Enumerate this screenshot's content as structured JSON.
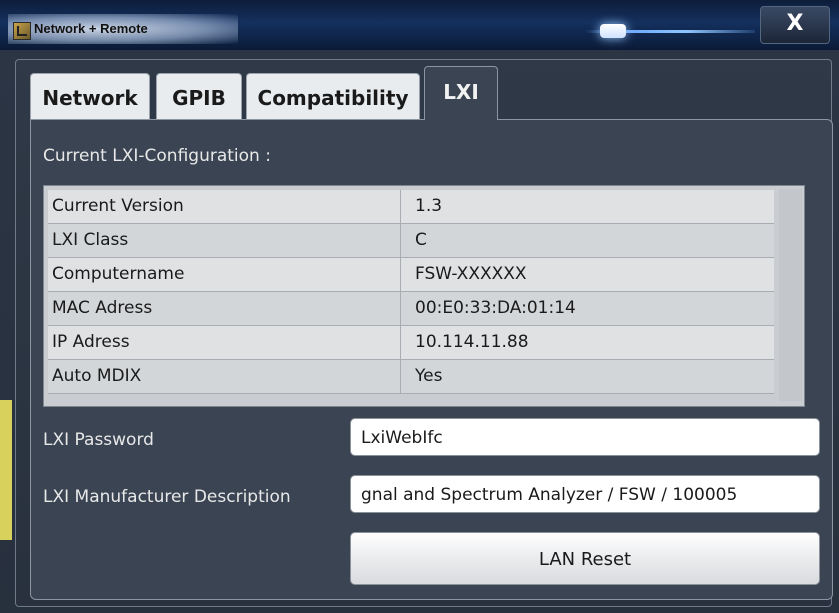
{
  "window": {
    "title": "Network + Remote",
    "close_label": "X"
  },
  "tabs": [
    {
      "label": "Network",
      "active": false
    },
    {
      "label": "GPIB",
      "active": false
    },
    {
      "label": "Compatibility",
      "active": false
    },
    {
      "label": "LXI",
      "active": true
    }
  ],
  "lxi": {
    "section_label": "Current LXI-Configuration :",
    "table": [
      {
        "key": "Current Version",
        "value": "1.3"
      },
      {
        "key": "LXI Class",
        "value": "C"
      },
      {
        "key": "Computername",
        "value": "FSW-XXXXXX"
      },
      {
        "key": "MAC Adress",
        "value": "00:E0:33:DA:01:14"
      },
      {
        "key": "IP Adress",
        "value": "10.114.11.88"
      },
      {
        "key": "Auto MDIX",
        "value": "Yes"
      }
    ],
    "password_label": "LXI Password",
    "password_value": "LxiWebIfc",
    "manufacturer_label": "LXI Manufacturer Description",
    "manufacturer_value": "gnal and Spectrum Analyzer / FSW / 100005",
    "lan_reset_label": "LAN Reset"
  },
  "colors": {
    "title_bar": "#14305e",
    "panel_bg": "#3a4452",
    "accent_yellow": "#d8d25c"
  }
}
